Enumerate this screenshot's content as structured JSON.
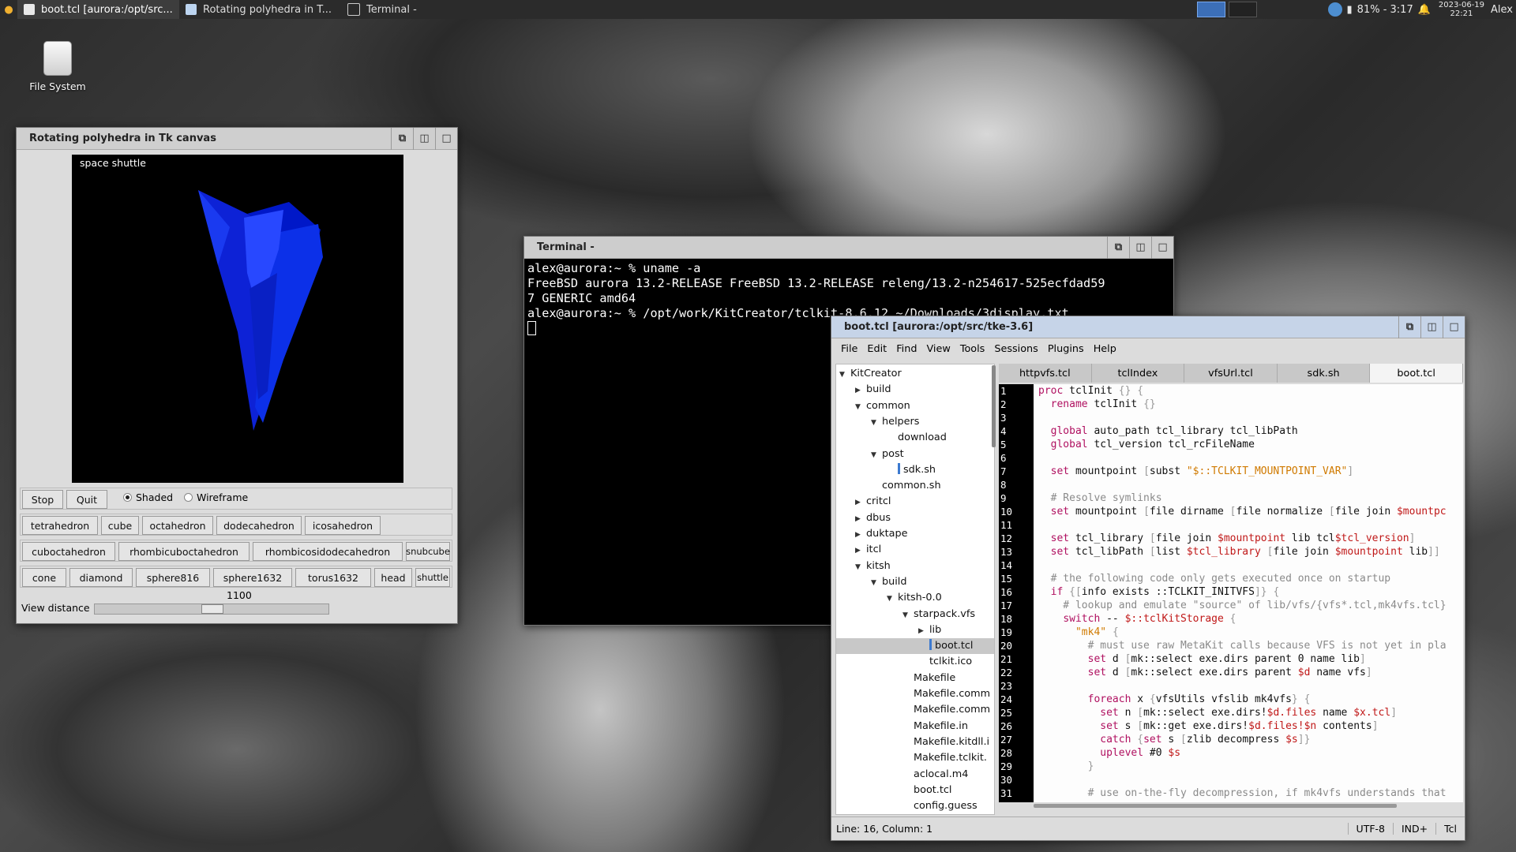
{
  "taskbar": {
    "tasks": [
      {
        "label": "boot.tcl [aurora:/opt/src...",
        "icon": "text-editor-icon",
        "color": "#e8e8e8"
      },
      {
        "label": "Rotating polyhedra in T...",
        "icon": "tk-window-icon",
        "color": "#bcd4f0"
      },
      {
        "label": "Terminal -",
        "icon": "terminal-icon",
        "color": "#d8d8d8"
      }
    ],
    "battery": "81% - 3:17",
    "date": "2023-06-19",
    "time": "22:21",
    "user": "Alex"
  },
  "desktop": {
    "icon_label": "File System"
  },
  "polyhedra": {
    "title": "Rotating polyhedra in Tk canvas",
    "canvas_label": "space shuttle",
    "stop": "Stop",
    "quit": "Quit",
    "shaded": "Shaded",
    "wireframe": "Wireframe",
    "render_mode": "Shaded",
    "row1": [
      "tetrahedron",
      "cube",
      "octahedron",
      "dodecahedron",
      "icosahedron"
    ],
    "row2": [
      "cuboctahedron",
      "rhombicuboctahedron",
      "rhombicosidodecahedron",
      "snubcube"
    ],
    "row3": [
      "cone",
      "diamond",
      "sphere816",
      "sphere1632",
      "torus1632",
      "head",
      "shuttle"
    ],
    "view_distance_label": "View distance",
    "view_distance": "1100",
    "view_distance_fraction": 0.5
  },
  "terminal": {
    "title": "Terminal -",
    "lines": [
      "alex@aurora:~ % uname -a",
      "FreeBSD aurora 13.2-RELEASE FreeBSD 13.2-RELEASE releng/13.2-n254617-525ecfdad59",
      "7 GENERIC amd64",
      "alex@aurora:~ % /opt/work/KitCreator/tclkit-8.6.12 ~/Downloads/3display.txt"
    ]
  },
  "editor": {
    "title": "boot.tcl [aurora:/opt/src/tke-3.6]",
    "menu": [
      "File",
      "Edit",
      "Find",
      "View",
      "Tools",
      "Sessions",
      "Plugins",
      "Help"
    ],
    "tabs": [
      "httpvfs.tcl",
      "tclIndex",
      "vfsUrl.tcl",
      "sdk.sh",
      "boot.tcl"
    ],
    "active_tab": "boot.tcl",
    "tree": [
      {
        "label": "KitCreator",
        "toggle": "open"
      },
      {
        "label": "build",
        "toggle": "closed"
      },
      {
        "label": "common",
        "toggle": "open"
      },
      {
        "label": "helpers",
        "toggle": "open"
      },
      {
        "label": "download",
        "toggle": ""
      },
      {
        "label": "post",
        "toggle": "open"
      },
      {
        "label": "sdk.sh",
        "toggle": "",
        "mark": true
      },
      {
        "label": "common.sh",
        "toggle": ""
      },
      {
        "label": "critcl",
        "toggle": "closed"
      },
      {
        "label": "dbus",
        "toggle": "closed"
      },
      {
        "label": "duktape",
        "toggle": "closed"
      },
      {
        "label": "itcl",
        "toggle": "closed"
      },
      {
        "label": "kitsh",
        "toggle": "open"
      },
      {
        "label": "build",
        "toggle": "open"
      },
      {
        "label": "kitsh-0.0",
        "toggle": "open"
      },
      {
        "label": "starpack.vfs",
        "toggle": "open"
      },
      {
        "label": "lib",
        "toggle": "closed"
      },
      {
        "label": "boot.tcl",
        "toggle": "",
        "mark": true,
        "selected": true
      },
      {
        "label": "tclkit.ico",
        "toggle": ""
      },
      {
        "label": "Makefile",
        "toggle": ""
      },
      {
        "label": "Makefile.comm",
        "toggle": ""
      },
      {
        "label": "Makefile.comm",
        "toggle": ""
      },
      {
        "label": "Makefile.in",
        "toggle": ""
      },
      {
        "label": "Makefile.kitdll.i",
        "toggle": ""
      },
      {
        "label": "Makefile.tclkit.",
        "toggle": ""
      },
      {
        "label": "aclocal.m4",
        "toggle": ""
      },
      {
        "label": "boot.tcl",
        "toggle": ""
      },
      {
        "label": "config.guess",
        "toggle": ""
      }
    ],
    "line_numbers": [
      "1",
      "2",
      "3",
      "4",
      "5",
      "6",
      "7",
      "8",
      "9",
      "10",
      "11",
      "12",
      "13",
      "14",
      "15",
      "16",
      "17",
      "18",
      "19",
      "20",
      "21",
      "22",
      "23",
      "24",
      "25",
      "26",
      "27",
      "28",
      "29",
      "30",
      "31"
    ],
    "code": [
      "proc tclInit {} {",
      "  rename tclInit {}",
      "",
      "  global auto_path tcl_library tcl_libPath",
      "  global tcl_version tcl_rcFileName",
      "",
      "  set mountpoint [subst \"$::TCLKIT_MOUNTPOINT_VAR\"]",
      "",
      "  # Resolve symlinks",
      "  set mountpoint [file dirname [file normalize [file join $mountpc",
      "",
      "  set tcl_library [file join $mountpoint lib tcl$tcl_version]",
      "  set tcl_libPath [list $tcl_library [file join $mountpoint lib]]",
      "",
      "  # the following code only gets executed once on startup",
      "  if {[info exists ::TCLKIT_INITVFS]} {",
      "    # lookup and emulate \"source\" of lib/vfs/{vfs*.tcl,mk4vfs.tcl}",
      "    switch -- $::tclKitStorage {",
      "      \"mk4\" {",
      "        # must use raw MetaKit calls because VFS is not yet in pla",
      "        set d [mk::select exe.dirs parent 0 name lib]",
      "        set d [mk::select exe.dirs parent $d name vfs]",
      "",
      "        foreach x {vfsUtils vfslib mk4vfs} {",
      "          set n [mk::select exe.dirs!$d.files name $x.tcl]",
      "          set s [mk::get exe.dirs!$d.files!$n contents]",
      "          catch {set s [zlib decompress $s]}",
      "          uplevel #0 $s",
      "        }",
      "",
      "        # use on-the-fly decompression, if mk4vfs understands that"
    ],
    "status_position": "Line: 16, Column: 1",
    "encoding": "UTF-8",
    "indent": "IND+",
    "language": "Tcl"
  }
}
